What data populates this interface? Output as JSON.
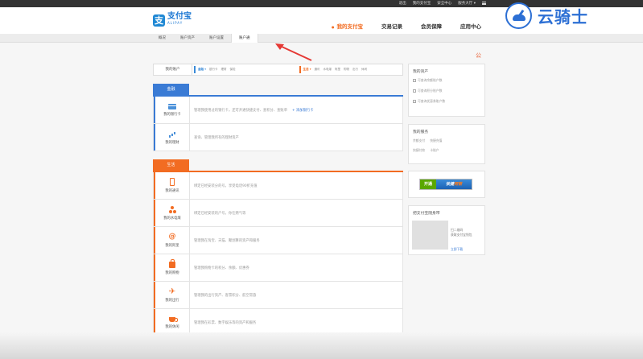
{
  "topbar": {
    "links": [
      "退出",
      "我的支付宝",
      "安全中心",
      "服务大厅 ▾"
    ]
  },
  "header": {
    "logo_cn": "支付宝",
    "logo_en": "ALIPAY",
    "nav": [
      "我的支付宝",
      "交易记录",
      "会员保障",
      "应用中心"
    ]
  },
  "watermark": {
    "text": "云骑士"
  },
  "subnav": {
    "tabs": [
      "概况",
      "账户资产",
      "账户设置",
      "账户通"
    ]
  },
  "settings_glyph": "公",
  "accounts": {
    "label": "我的账户",
    "fin_head": "金融 ▾",
    "fin_items": [
      "银行卡",
      "理财",
      "保险"
    ],
    "life_head": "生活 ▾",
    "life_items": [
      "通讯",
      "水电煤",
      "阿里",
      "购物",
      "出行",
      "休闲"
    ]
  },
  "finance": {
    "tag": "金融",
    "items": [
      {
        "icon": "bank-card-icon",
        "name": "我的银行卡",
        "desc": "管理我使用过的银行卡，还可开通快捷支付、查积分、查账单",
        "link": "+ 添加银行卡"
      },
      {
        "icon": "wealth-chart-icon",
        "name": "我的理财",
        "desc": "查询、管理我所有的理财资产",
        "link": ""
      }
    ]
  },
  "life": {
    "tag": "生活",
    "items": [
      {
        "icon": "phone-icon",
        "name": "我的通讯",
        "desc": "绑定已经安装分的号，享受电话90折充值"
      },
      {
        "icon": "utilities-icon",
        "name": "我的水电煤",
        "desc": "绑定已经安装的户号，你在燃气等"
      },
      {
        "icon": "alibaba-icon",
        "name": "我的阿里",
        "desc": "管理我在淘宝、天猫、聚划算的资产和服务"
      },
      {
        "icon": "shopping-bag-icon",
        "name": "我的购物",
        "desc": "管理我购物卡的积分、余额、优惠券"
      },
      {
        "icon": "plane-icon",
        "name": "我的出行",
        "desc": "管理我的出行资产、客票积分、航空常旅"
      },
      {
        "icon": "coffee-icon",
        "name": "我的休闲",
        "desc": "管理我在彩票、数字娱乐等的资产和服务"
      }
    ]
  },
  "sidebar": {
    "assets_title": "我的资产",
    "assets_items": [
      "可查询余额账户数",
      "可查询积分账户数",
      "可查询优惠券账户数"
    ],
    "services_title": "我的服务",
    "services_rows": [
      [
        "余额支付",
        "快捷充值"
      ],
      [
        "快捷付款",
        "卡账户"
      ]
    ],
    "promo_a": "开通",
    "promo_b_white": "快捷",
    "promo_b_orange": "网银",
    "qr_title": "把支付宝随身带",
    "qr_lines": [
      "扫二维码",
      "获取支付宝钱包"
    ],
    "qr_link": "立即下载"
  }
}
